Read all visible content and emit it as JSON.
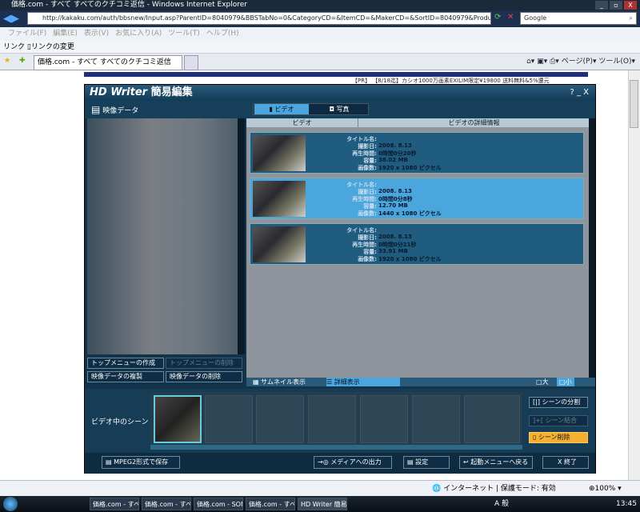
{
  "browser": {
    "title": "価格.com - すべて すべてのクチコミ返信 - Windows Internet Explorer",
    "url": "http://kakaku.com/auth/bbsnew/Input.asp?ParentID=8040979&BBSTabNo=0&CategoryCD=&ItemCD=&MakerCD=&SortID=8040979&ProductID",
    "search_placeholder": "Google",
    "menu": [
      "ファイル(F)",
      "編集(E)",
      "表示(V)",
      "お気に入り(A)",
      "ツール(T)",
      "ヘルプ(H)"
    ],
    "links_label": "リンク",
    "links_item": "リンクの変更",
    "tab": "価格.com - すべて すべてのクチコミ返信",
    "page_menu": "ページ(P)",
    "tools_menu": "ツール(O)",
    "status_zone": "インターネット | 保護モード: 有効",
    "zoom": "100%"
  },
  "page": {
    "pr": "【PR】 【8/18迄】カシオ1000万画素EXILIM限定¥19800 送料無料&5%還元"
  },
  "app": {
    "title": "HD Writer",
    "title_sub": "簡易編集",
    "controls": "?  _  X",
    "section": "映像データ",
    "tab_video": "ビデオ",
    "tab_photo": "写真",
    "col_video": "ビデオ",
    "col_detail": "ビデオの詳細情報",
    "labels": [
      "タイトル名:",
      "撮影日:",
      "再生時間:",
      "容量:",
      "画像数:"
    ],
    "videos": [
      {
        "title": "",
        "date": "2008. 8.13",
        "duration": "0時間0分20秒",
        "size": "38.02 MB",
        "resolution": "1920 x 1080 ピクセル",
        "selected": false
      },
      {
        "title": "",
        "date": "2008. 8.13",
        "duration": "0時間0分8秒",
        "size": "12.70 MB",
        "resolution": "1440 x 1080 ピクセル",
        "selected": true
      },
      {
        "title": "",
        "date": "2008. 8.13",
        "duration": "0時間0分21秒",
        "size": "33.91 MB",
        "resolution": "1920 x 1080 ピクセル",
        "selected": false
      }
    ],
    "btn_top_create": "トップメニューの作成",
    "btn_top_delete": "トップメニューの削除",
    "btn_copy": "映像データの複製",
    "btn_delete": "映像データの削除",
    "view_thumb": "サムネイル表示",
    "view_detail": "詳細表示",
    "size_large": "大",
    "size_small": "小",
    "scenes_label": "ビデオ中のシーン",
    "btn_split": "シーンの分割",
    "btn_join": "シーン結合",
    "btn_scene_delete": "シーン削除",
    "btn_mpeg2": "MPEG2形式で保存",
    "btn_media": "メディアへの出力",
    "btn_settings": "設定",
    "btn_back": "起動メニューへ戻る",
    "btn_exit": "X  終了"
  },
  "taskbar": {
    "items": [
      "価格.com - すべて...",
      "価格.com - すべて...",
      "価格.com - SONY...",
      "価格.com - すべて...",
      "HD Writer 簡易編集"
    ],
    "ime": "A 般",
    "clock": "13:45"
  }
}
